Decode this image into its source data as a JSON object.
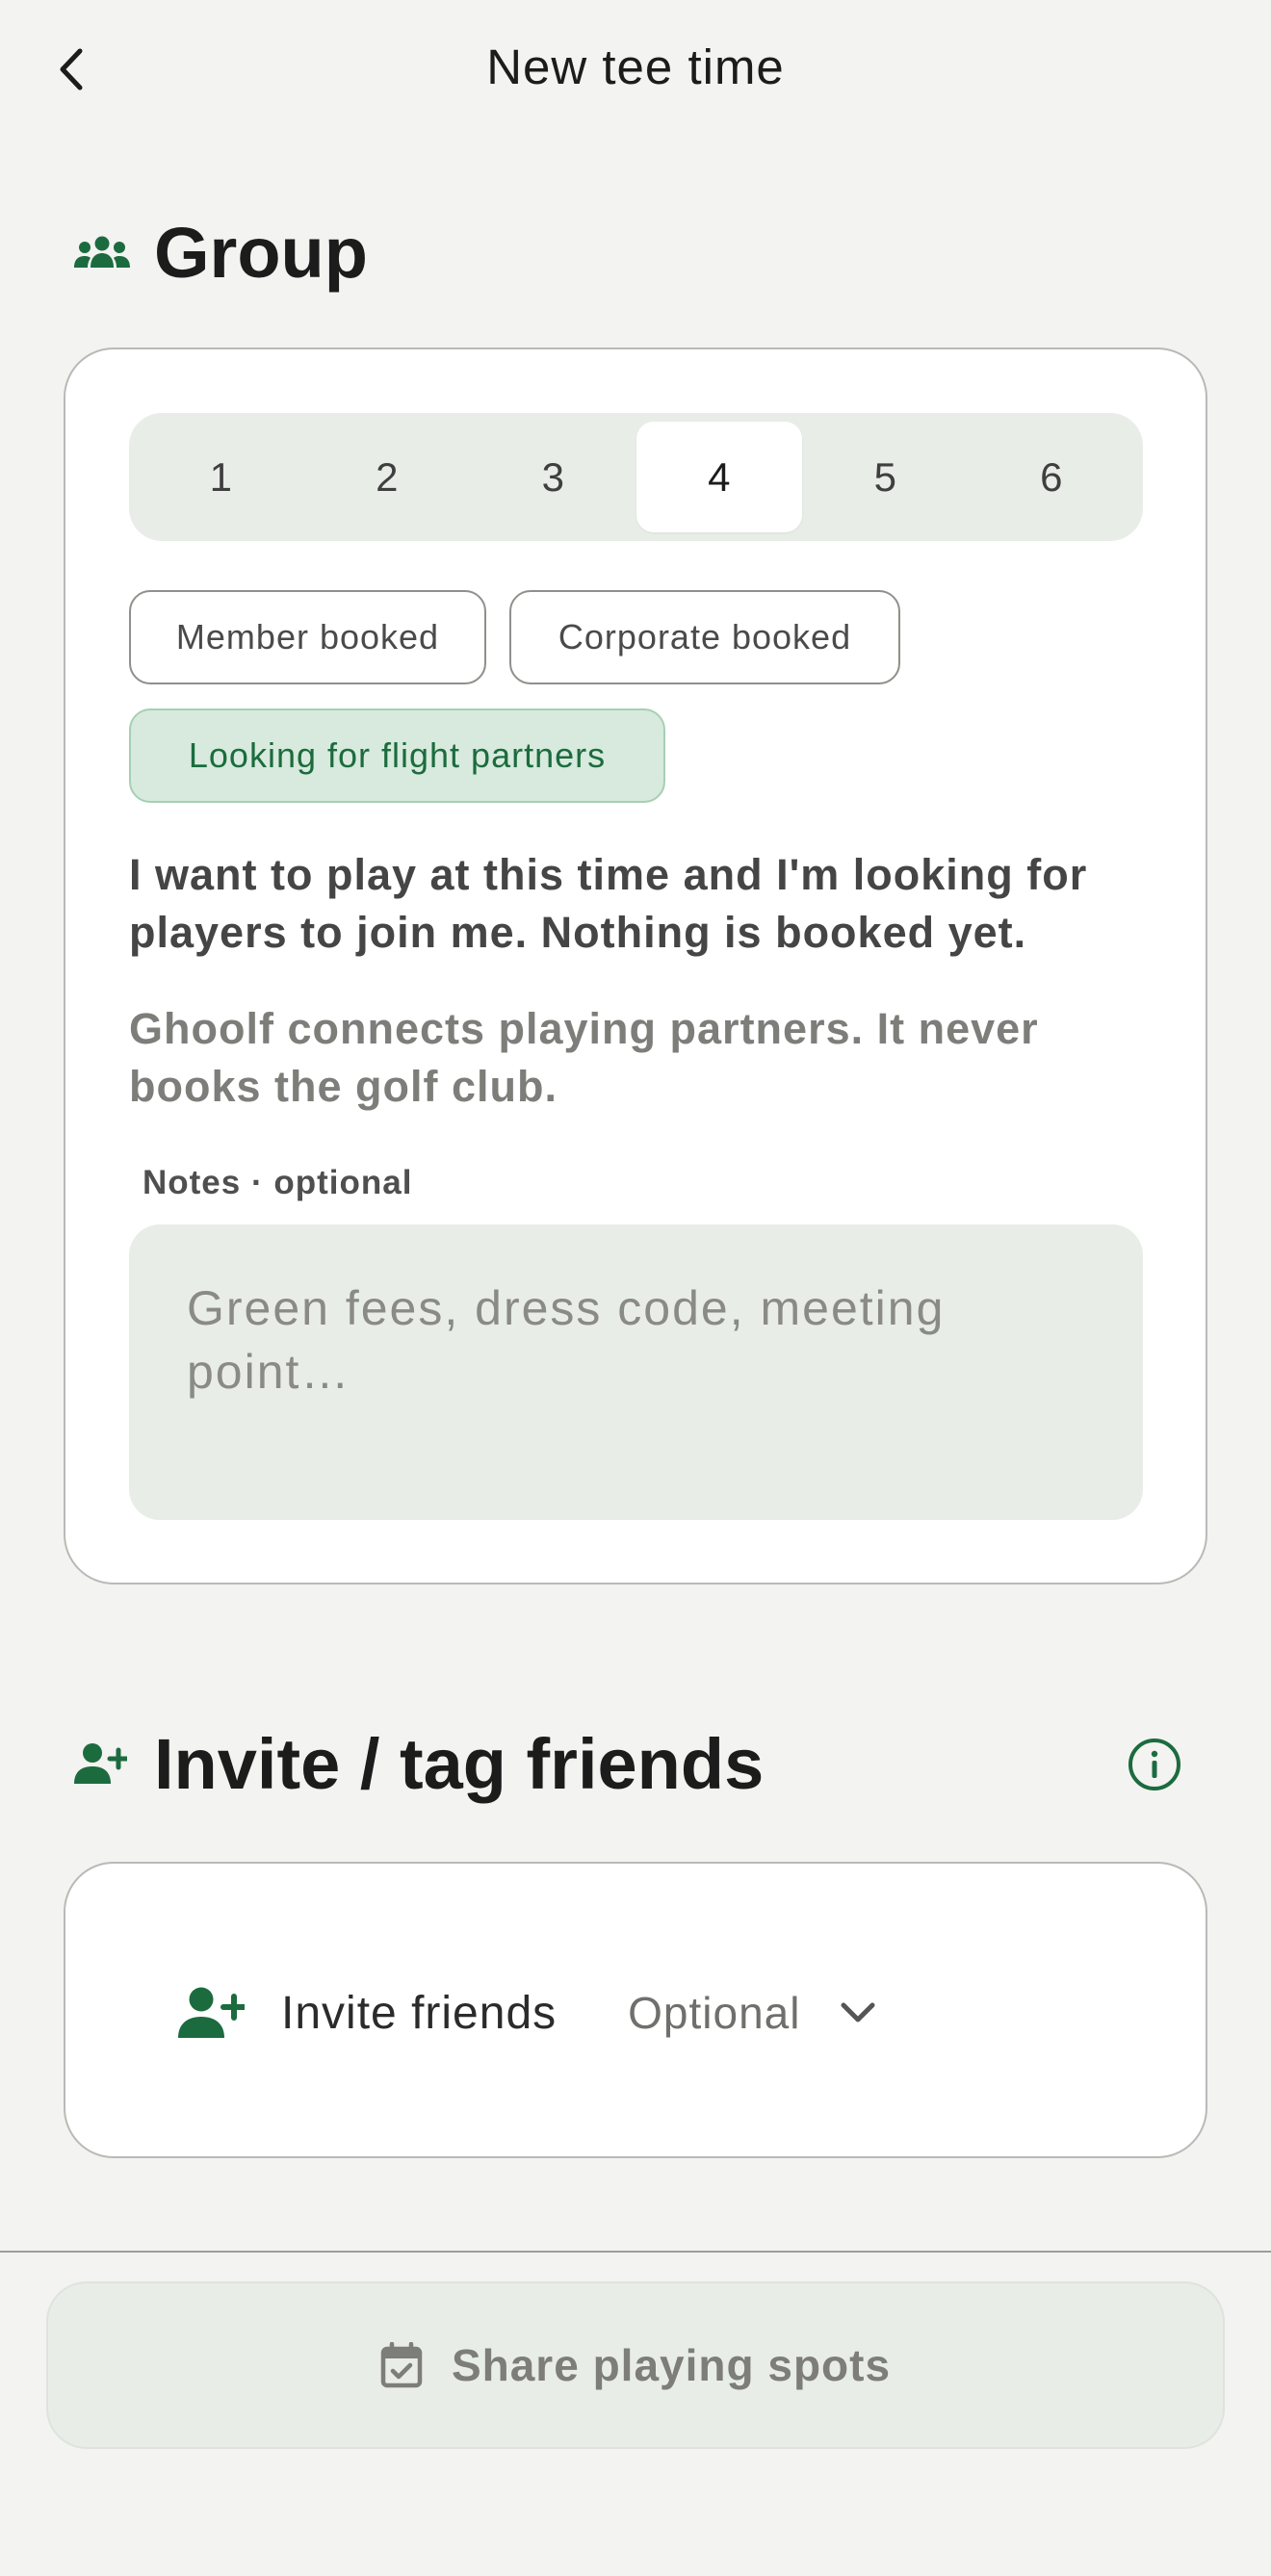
{
  "header": {
    "title": "New tee time"
  },
  "group": {
    "title": "Group",
    "player_counts": [
      "1",
      "2",
      "3",
      "4",
      "5",
      "6"
    ],
    "selected_count": "4",
    "booking_types": {
      "member": "Member booked",
      "corporate": "Corporate booked",
      "flight": "Looking for flight partners"
    },
    "selected_booking_type": "Looking for flight partners",
    "description": "I want to play at this time and I'm looking for players to join me. Nothing is booked yet.",
    "disclaimer": "Ghoolf connects playing partners. It never books the golf club.",
    "notes_label": "Notes · optional",
    "notes_value": "",
    "notes_placeholder": "Green fees, dress code, meeting point…"
  },
  "invite": {
    "title": "Invite / tag friends",
    "row_label": "Invite friends",
    "row_value": "Optional"
  },
  "footer": {
    "share_label": "Share playing spots"
  },
  "colors": {
    "accent": "#1c6b3e",
    "background": "#f3f3f1",
    "chip_selected_bg": "#d7eadd",
    "input_bg": "#e9ede8"
  },
  "icons": {
    "back": "chevron-left-icon",
    "group": "group-icon",
    "invite": "person-add-icon",
    "info": "info-icon",
    "dropdown": "chevron-down-icon",
    "calendar": "calendar-check-icon"
  }
}
